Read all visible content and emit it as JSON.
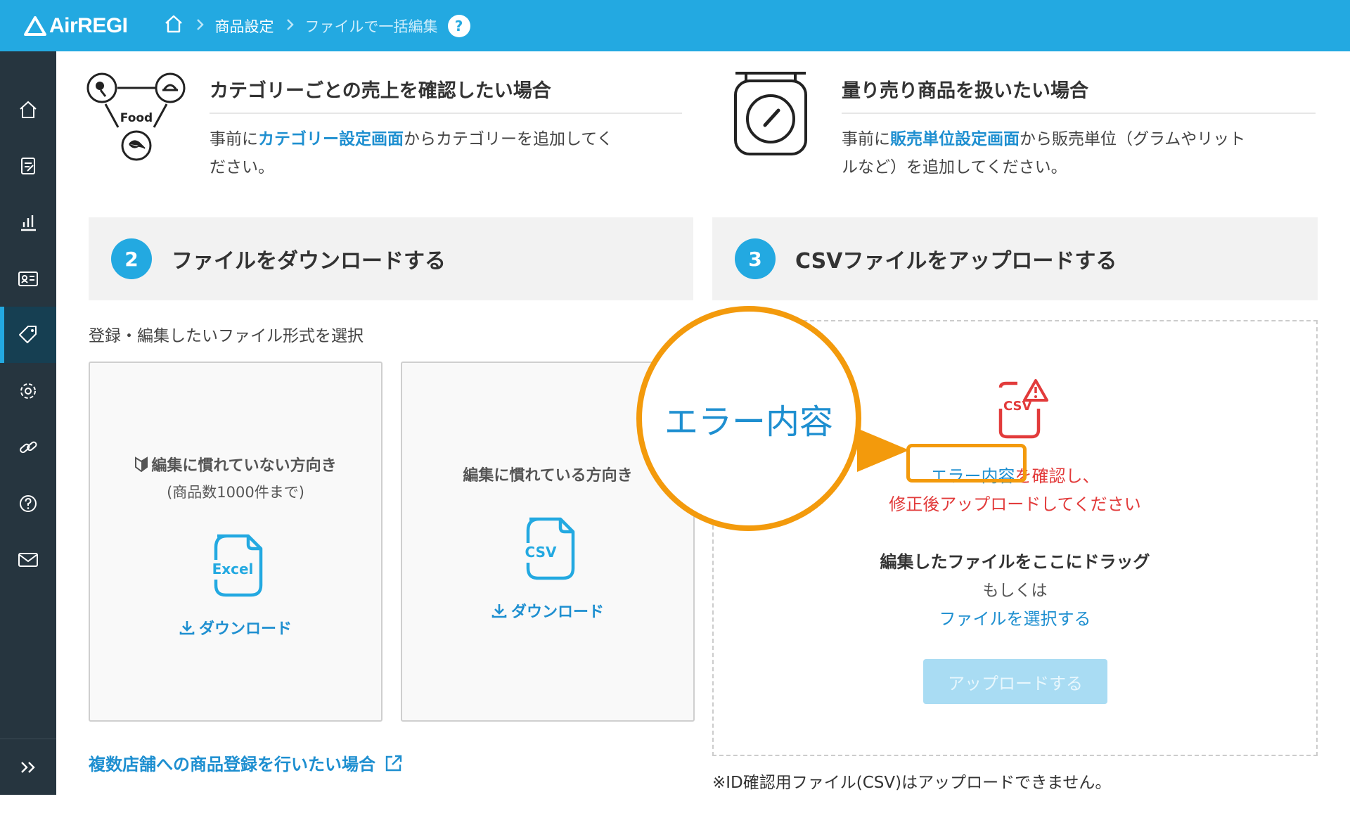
{
  "header": {
    "logo_text": "AirREGI",
    "breadcrumb": [
      "商品設定",
      "ファイルで一括編集"
    ],
    "help_glyph": "?"
  },
  "sidebar": {
    "items": [
      "home-icon",
      "order-icon",
      "chart-icon",
      "customer-card-icon",
      "price-tag-icon",
      "gear-icon",
      "link-icon",
      "help-icon",
      "mail-icon"
    ],
    "active_index": 4,
    "expand_glyph": ">>"
  },
  "info": {
    "category": {
      "title": "カテゴリーごとの売上を確認したい場合",
      "text_before": "事前に",
      "link": "カテゴリー設定画面",
      "text_after": "からカテゴリーを追加してく",
      "text_line2": "ださい。",
      "icon_label": "Food"
    },
    "weight": {
      "title": "量り売り商品を扱いたい場合",
      "text_before": "事前に",
      "link": "販売単位設定画面",
      "text_after": "から販売単位（グラムやリット",
      "text_line2": "ルなど）を追加してください。"
    }
  },
  "step2": {
    "number": "2",
    "title": "ファイルをダウンロードする",
    "select_label": "登録・編集したいファイル形式を選択",
    "cards": [
      {
        "desc": "編集に慣れていない方向き",
        "sub": "(商品数1000件まで)",
        "file_label": "Excel",
        "download": "ダウンロード"
      },
      {
        "desc": "編集に慣れている方向き",
        "file_label": "CSV",
        "download": "ダウンロード"
      }
    ],
    "multi_store_link": "複数店舗への商品登録を行いたい場合"
  },
  "step3": {
    "number": "3",
    "title": "CSVファイルをアップロードする",
    "error_icon_label": "CSV",
    "error_link": "エラー内容",
    "error_text_1": "を確認し、",
    "error_text_2": "修正後アップロードしてください",
    "drag_text": "編集したファイルをここにドラッグ",
    "or_text": "もしくは",
    "select_file": "ファイルを選択する",
    "upload_button": "アップロードする",
    "note": "※ID確認用ファイル(CSV)はアップロードできません。"
  },
  "callout": {
    "text": "エラー内容"
  },
  "colors": {
    "header_blue": "#23a9e1",
    "sidebar_dark": "#26353f",
    "link_blue": "#1e8fd0",
    "error_red": "#e23b3b",
    "callout_orange": "#f39a0c"
  }
}
